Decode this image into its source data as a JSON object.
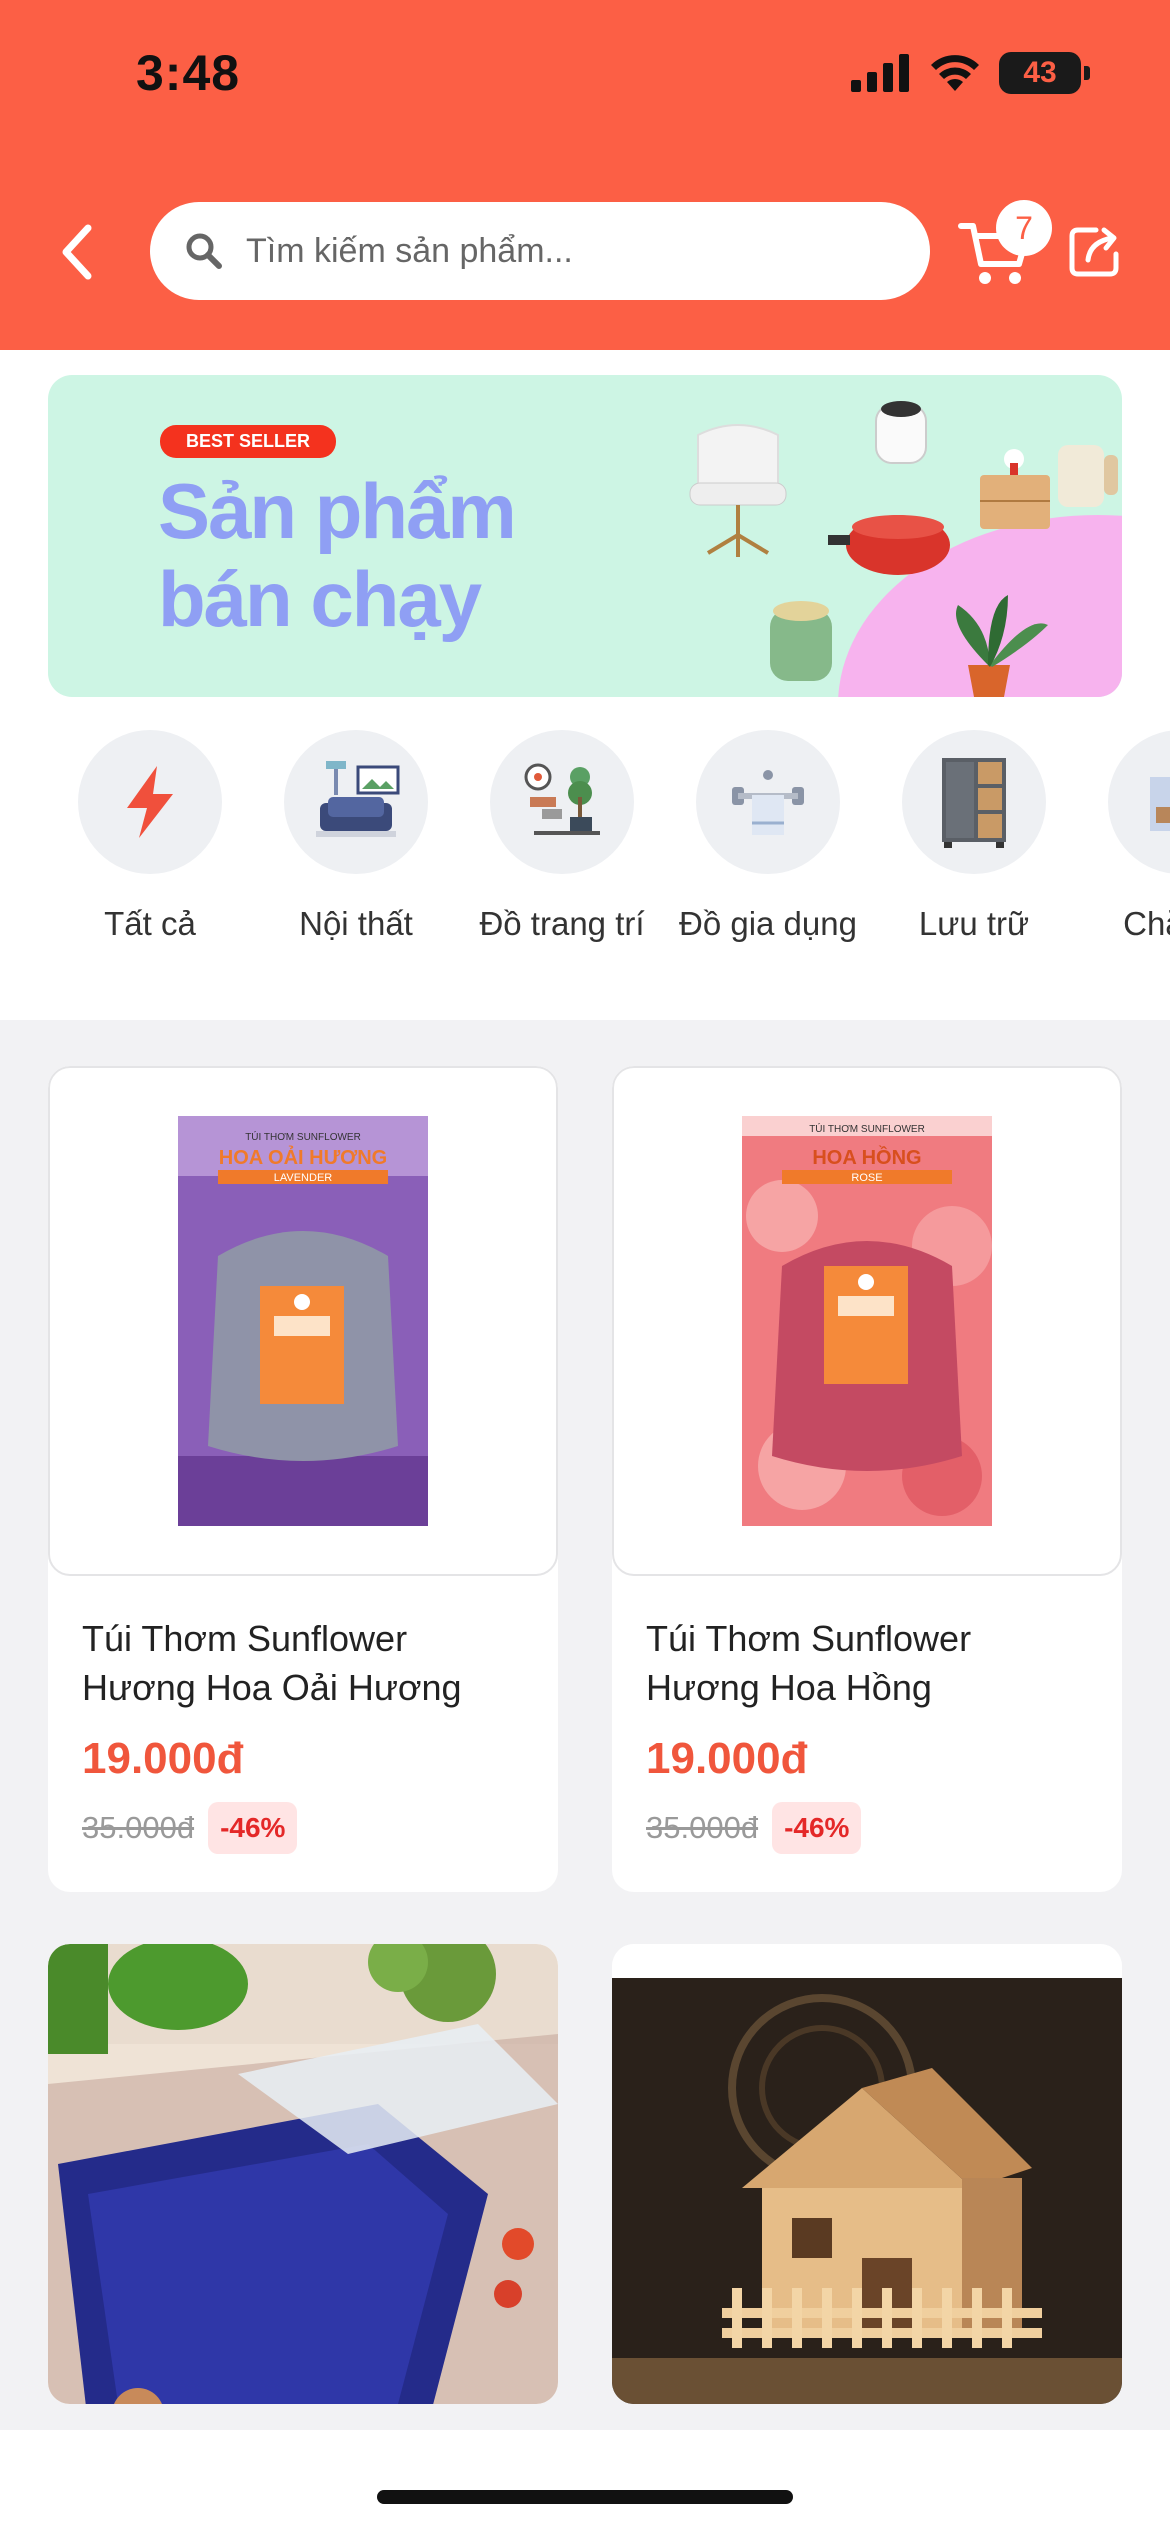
{
  "status_bar": {
    "time": "3:48",
    "battery": "43"
  },
  "header": {
    "search_placeholder": "Tìm kiếm sản phẩm...",
    "cart_count": "7"
  },
  "banner": {
    "badge": "BEST SELLER",
    "title_line1": "Sản phẩm",
    "title_line2": "bán chạy"
  },
  "categories": [
    {
      "label": "Tất cả",
      "icon": "lightning-icon"
    },
    {
      "label": "Nội thất",
      "icon": "sofa-icon"
    },
    {
      "label": "Đồ trang trí",
      "icon": "decor-plant-icon"
    },
    {
      "label": "Đồ gia dụng",
      "icon": "towel-rack-icon"
    },
    {
      "label": "Lưu trữ",
      "icon": "wardrobe-icon"
    },
    {
      "label": "Chă gối",
      "icon": "bedding-icon"
    }
  ],
  "products": [
    {
      "name": "Túi Thơm Sunflower Hương Hoa Oải Hương",
      "price": "19.000đ",
      "old_price": "35.000đ",
      "discount": "-46%",
      "image_label": "HOA OẢI HƯƠNG",
      "image_sub": "LAVENDER",
      "image_top": "TÚI THƠM SUNFLOWER"
    },
    {
      "name": "Túi Thơm Sunflower Hương Hoa Hồng",
      "price": "19.000đ",
      "old_price": "35.000đ",
      "discount": "-46%",
      "image_label": "HOA HỒNG",
      "image_sub": "ROSE",
      "image_top": "TÚI THƠM SUNFLOWER"
    },
    {
      "name": "",
      "price": "",
      "old_price": "",
      "discount": ""
    },
    {
      "name": "",
      "price": "",
      "old_price": "",
      "discount": ""
    }
  ],
  "colors": {
    "brand": "#fc5f45",
    "price": "#f0563c",
    "discount_bg": "#ffe4e4",
    "banner_bg": "#cdf5e4",
    "banner_title": "#8f9ff4"
  }
}
